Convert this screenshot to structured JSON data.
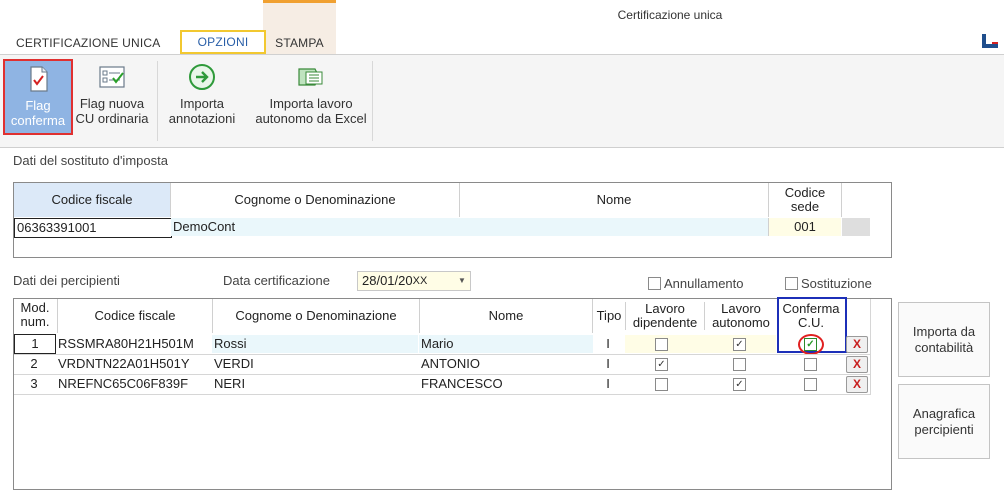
{
  "window": {
    "title": "Certificazione unica"
  },
  "tabs": [
    {
      "label": "CERTIFICAZIONE UNICA"
    },
    {
      "label": "OPZIONI"
    },
    {
      "label": "STAMPA"
    }
  ],
  "ribbon": {
    "flag_conferma": [
      "Flag",
      "conferma"
    ],
    "flag_nuova": [
      "Flag nuova",
      "CU ordinaria"
    ],
    "importa_annotazioni": [
      "Importa",
      "annotazioni"
    ],
    "importa_lavoro": [
      "Importa lavoro",
      "autonomo da Excel"
    ]
  },
  "sostituto": {
    "section_label": "Dati del sostituto d'imposta",
    "headers": {
      "codice_fiscale": "Codice fiscale",
      "cognome": "Cognome o Denominazione",
      "nome": "Nome",
      "codice_sede": [
        "Codice",
        "sede"
      ]
    },
    "row": {
      "codice_fiscale": "06363391001",
      "cognome": "DemoCont",
      "nome": "",
      "codice_sede": "001"
    }
  },
  "percipienti": {
    "section_label": "Dati dei percipienti",
    "data_cert_label": "Data certificazione",
    "data_cert_value": "28/01/20",
    "data_cert_suffix": "XX",
    "annullamento_label": "Annullamento",
    "sostituzione_label": "Sostituzione",
    "headers": {
      "mod": [
        "Mod.",
        "num."
      ],
      "codice_fiscale": "Codice fiscale",
      "cognome": "Cognome o Denominazione",
      "nome": "Nome",
      "tipo": "Tipo",
      "lavoro_dip": [
        "Lavoro",
        "dipendente"
      ],
      "lavoro_aut": [
        "Lavoro",
        "autonomo"
      ],
      "conferma": [
        "Conferma",
        "C.U."
      ]
    },
    "rows": [
      {
        "mod": "1",
        "codice_fiscale": "RSSMRA80H21H501M",
        "cognome": "Rossi",
        "nome": "Mario",
        "tipo": "I",
        "dipendente": false,
        "autonomo": true,
        "conferma": true
      },
      {
        "mod": "2",
        "codice_fiscale": "VRDNTN22A01H501Y",
        "cognome": "VERDI",
        "nome": "ANTONIO",
        "tipo": "I",
        "dipendente": true,
        "autonomo": false,
        "conferma": false
      },
      {
        "mod": "3",
        "codice_fiscale": "NREFNC65C06F839F",
        "cognome": "NERI",
        "nome": "FRANCESCO",
        "tipo": "I",
        "dipendente": false,
        "autonomo": true,
        "conferma": false
      }
    ],
    "delete_label": "X"
  },
  "side_buttons": {
    "importa": [
      "Importa da",
      "contabilità"
    ],
    "anagrafica": [
      "Anagrafica",
      "percipienti"
    ]
  },
  "colors": {
    "accent": "#1f4e8c",
    "highlight_red": "#e03030",
    "header_blue": "#dce9f8",
    "row_cyan": "#eaf7fb",
    "sede_yellow": "#fffde6"
  }
}
